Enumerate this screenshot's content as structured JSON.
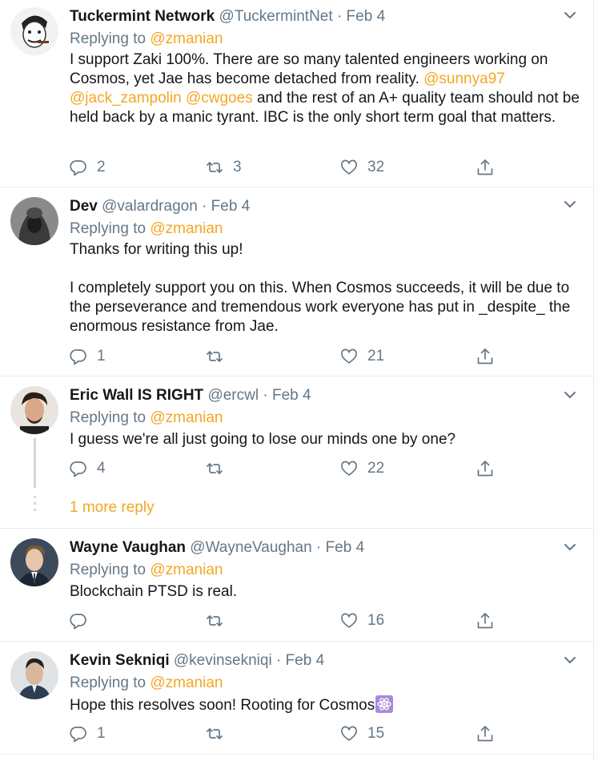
{
  "tweets": [
    {
      "name": "Tuckermint Network",
      "handle": "@TuckermintNet",
      "date": "Feb 4",
      "replying_to": "Replying to",
      "mention": "@zmanian",
      "text_parts": [
        "I support Zaki 100%. There are so many talented engineers working on Cosmos, yet Jae has become detached from reality. ",
        "@sunnya97",
        " ",
        "@jack_zampolin",
        " ",
        "@cwgoes",
        " and the rest of an A+ quality team should not be held back by a manic tyrant. IBC is the only short term goal that matters."
      ],
      "replies": "2",
      "retweets": "3",
      "likes": "32"
    },
    {
      "name": "Dev",
      "handle": "@valardragon",
      "date": "Feb 4",
      "replying_to": "Replying to",
      "mention": "@zmanian",
      "text_p1": "Thanks for writing this up!",
      "text_p2": "I completely support you on this. When Cosmos succeeds, it will be due to the perseverance and tremendous work everyone has put in _despite_ the enormous resistance from Jae.",
      "replies": "1",
      "retweets": "",
      "likes": "21"
    },
    {
      "name": "Eric Wall IS RIGHT",
      "handle": "@ercwl",
      "date": "Feb 4",
      "replying_to": "Replying to",
      "mention": "@zmanian",
      "text": "I guess we're all just going to lose our minds one by one?",
      "replies": "4",
      "retweets": "",
      "likes": "22",
      "more_replies": "1 more reply"
    },
    {
      "name": "Wayne Vaughan",
      "handle": "@WayneVaughan",
      "date": "Feb 4",
      "replying_to": "Replying to",
      "mention": "@zmanian",
      "text": "Blockchain PTSD is real.",
      "replies": "",
      "retweets": "",
      "likes": "16"
    },
    {
      "name": "Kevin Sekniqi",
      "handle": "@kevinsekniqi",
      "date": "Feb 4",
      "replying_to": "Replying to",
      "mention": "@zmanian",
      "text": "Hope this resolves soon! Rooting for Cosmos",
      "emoji": "atom-symbol-emoji",
      "replies": "1",
      "retweets": "",
      "likes": "15"
    }
  ],
  "separator": "·",
  "colors": {
    "accent": "#f5a623",
    "muted": "#657786",
    "text": "#14171a",
    "border": "#e6ecf0"
  },
  "icons": {
    "reply": "reply-icon",
    "retweet": "retweet-icon",
    "like": "like-icon",
    "share": "share-icon",
    "caret": "chevron-down-icon"
  }
}
